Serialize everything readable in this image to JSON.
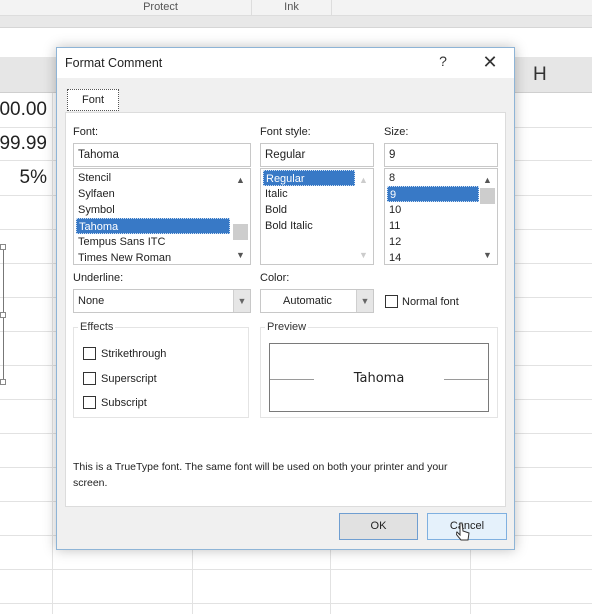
{
  "ribbon": {
    "groups": [
      "Protect",
      "Ink"
    ]
  },
  "sheet": {
    "column_letter": "H",
    "cell_values": [
      "00.00",
      "99.99",
      "5%"
    ]
  },
  "dialog": {
    "title": "Format Comment",
    "help_label": "?",
    "close_label": "✕",
    "tabs": [
      {
        "label": "Font",
        "active": true
      }
    ],
    "font": {
      "label": "Font:",
      "mnemonic": "F",
      "value": "Tahoma",
      "items": [
        "Stencil",
        "Sylfaen",
        "Symbol",
        "Tahoma",
        "Tempus Sans ITC",
        "Times New Roman"
      ],
      "selected": "Tahoma"
    },
    "font_style": {
      "label": "Font style:",
      "mnemonic": "o",
      "value": "Regular",
      "items": [
        "Regular",
        "Italic",
        "Bold",
        "Bold Italic"
      ],
      "selected": "Regular"
    },
    "size": {
      "label": "Size:",
      "mnemonic": "S",
      "value": "9",
      "items": [
        "8",
        "9",
        "10",
        "11",
        "12",
        "14"
      ],
      "selected": "9"
    },
    "underline": {
      "label": "Underline:",
      "mnemonic": "U",
      "value": "None"
    },
    "color": {
      "label": "Color:",
      "mnemonic": "C",
      "value": "Automatic"
    },
    "normal_font": {
      "label": "Normal font",
      "mnemonic": "N",
      "checked": false
    },
    "effects": {
      "title": "Effects",
      "items": [
        {
          "label": "Strikethrough",
          "checked": false
        },
        {
          "label": "Superscript",
          "checked": false
        },
        {
          "label": "Subscript",
          "checked": false
        }
      ]
    },
    "preview": {
      "title": "Preview",
      "sample_text": "Tahoma"
    },
    "info_text": "This is a TrueType font.  The same font will be used on both your printer and your screen.",
    "buttons": {
      "ok": "OK",
      "cancel": "Cancel"
    },
    "colors": {
      "selection": "#3879c6",
      "border": "#8eb4d6"
    }
  }
}
